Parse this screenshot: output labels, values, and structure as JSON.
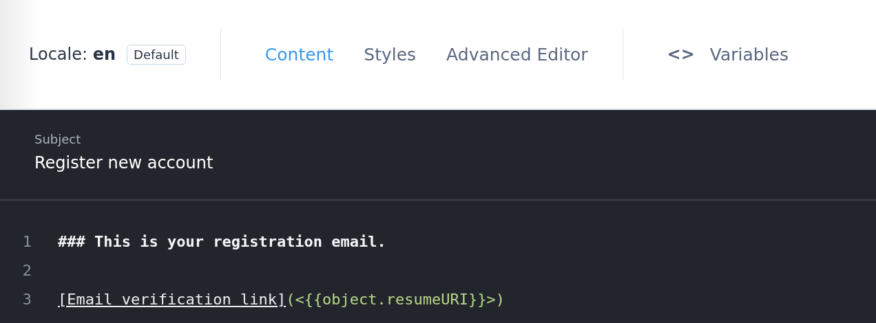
{
  "locale": {
    "label": "Locale:",
    "value": "en",
    "badge": "Default"
  },
  "tabs": [
    {
      "label": "Content",
      "selected": true
    },
    {
      "label": "Styles",
      "selected": false
    },
    {
      "label": "Advanced Editor",
      "selected": false
    }
  ],
  "variables": {
    "icon": "<>",
    "label": "Variables"
  },
  "subject": {
    "label": "Subject",
    "value": "Register new account"
  },
  "editor": {
    "lines": [
      {
        "number": "1",
        "tokens": [
          {
            "kind": "heading",
            "text": "### This is your registration email."
          }
        ]
      },
      {
        "number": "2"
      },
      {
        "number": "3",
        "tokens": [
          {
            "kind": "link-text",
            "text": "[Email verification link]"
          },
          {
            "kind": "link-url",
            "text": "(<{{object.resumeURI}}>)"
          }
        ]
      }
    ]
  }
}
